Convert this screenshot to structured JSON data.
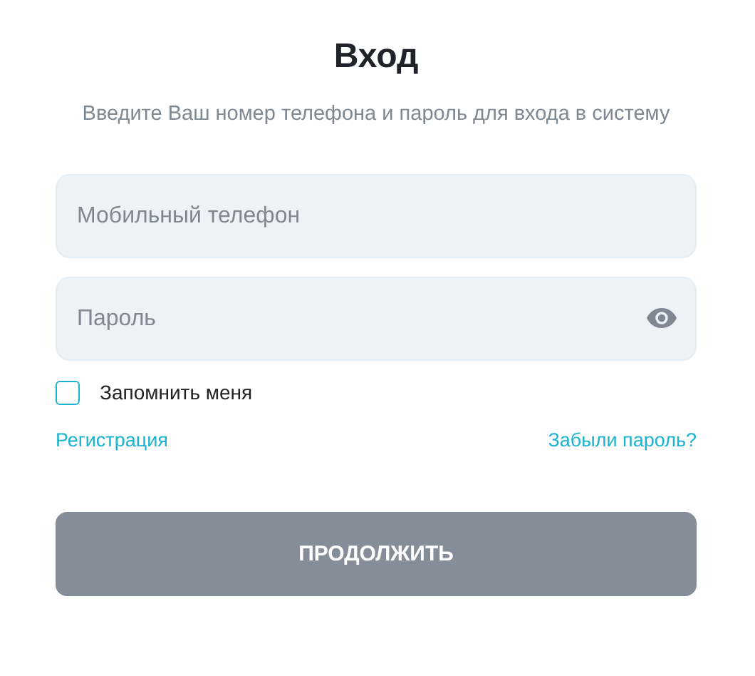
{
  "title": "Вход",
  "subtitle": "Введите Ваш номер телефона и пароль для входа в систему",
  "fields": [
    {
      "kind": "phone",
      "placeholder": "Мобильный телефон"
    },
    {
      "kind": "password",
      "placeholder": "Пароль"
    }
  ],
  "remember": {
    "label": "Запомнить меня",
    "checked": false
  },
  "links": [
    "Регистрация",
    "Забыли пароль?"
  ],
  "submit": {
    "label": "ПРОДОЛЖИТЬ",
    "disabled": true
  }
}
